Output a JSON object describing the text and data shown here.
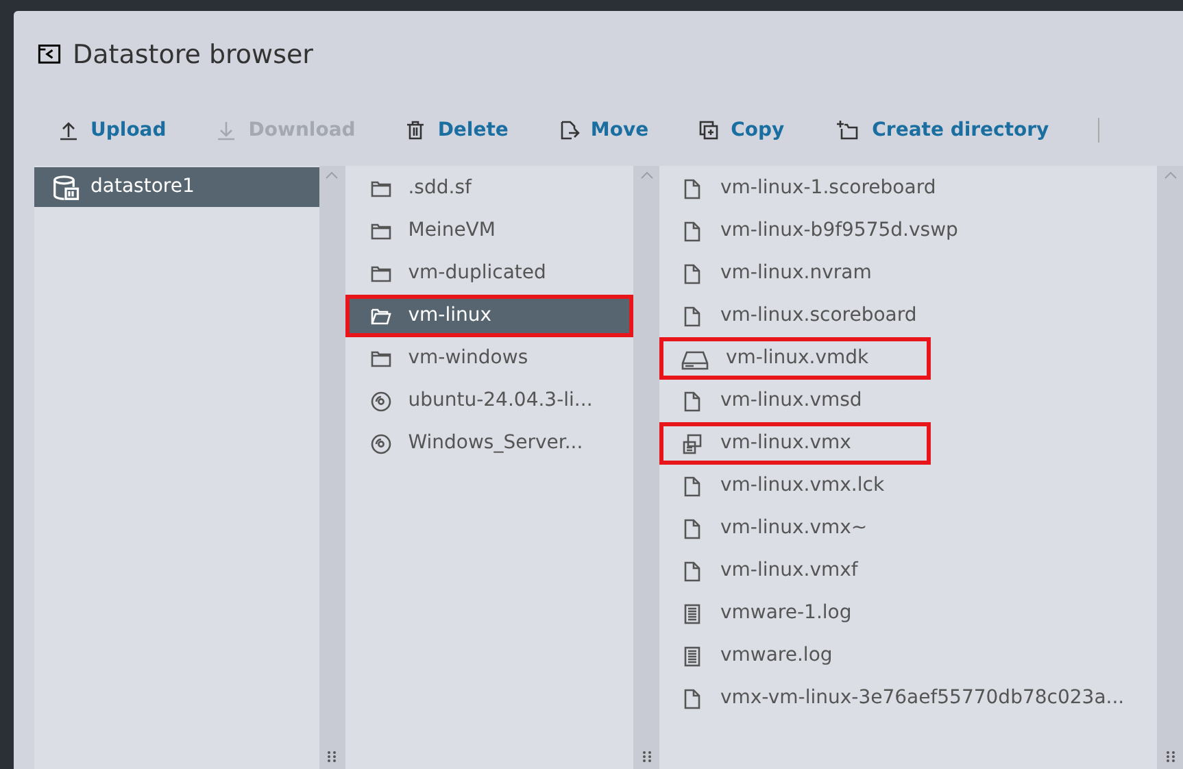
{
  "window": {
    "title": "Datastore browser"
  },
  "toolbar": [
    {
      "label": "Upload",
      "kind": "upload",
      "disabled": false
    },
    {
      "label": "Download",
      "kind": "download",
      "disabled": true
    },
    {
      "label": "Delete",
      "kind": "delete",
      "disabled": false
    },
    {
      "label": "Move",
      "kind": "move",
      "disabled": false
    },
    {
      "label": "Copy",
      "kind": "copy",
      "disabled": false
    },
    {
      "label": "Create directory",
      "kind": "mkdir",
      "disabled": false
    }
  ],
  "datastores": [
    {
      "name": "datastore1",
      "selected": true
    }
  ],
  "folders": [
    {
      "name": ".sdd.sf",
      "kind": "folder",
      "selected": false,
      "highlighted": false
    },
    {
      "name": "MeineVM",
      "kind": "folder",
      "selected": false,
      "highlighted": false
    },
    {
      "name": "vm-duplicated",
      "kind": "folder",
      "selected": false,
      "highlighted": false
    },
    {
      "name": "vm-linux",
      "kind": "folder",
      "selected": true,
      "highlighted": true
    },
    {
      "name": "vm-windows",
      "kind": "folder",
      "selected": false,
      "highlighted": false
    },
    {
      "name": "ubuntu-24.04.3-li...",
      "kind": "disc",
      "selected": false,
      "highlighted": false
    },
    {
      "name": "Windows_Server...",
      "kind": "disc",
      "selected": false,
      "highlighted": false
    }
  ],
  "files": [
    {
      "name": "vm-linux-1.scoreboard",
      "kind": "file",
      "highlighted": false
    },
    {
      "name": "vm-linux-b9f9575d.vswp",
      "kind": "file",
      "highlighted": false
    },
    {
      "name": "vm-linux.nvram",
      "kind": "file",
      "highlighted": false
    },
    {
      "name": "vm-linux.scoreboard",
      "kind": "file",
      "highlighted": false
    },
    {
      "name": "vm-linux.vmdk",
      "kind": "disk",
      "highlighted": true
    },
    {
      "name": "vm-linux.vmsd",
      "kind": "file",
      "highlighted": false
    },
    {
      "name": "vm-linux.vmx",
      "kind": "vm",
      "highlighted": true
    },
    {
      "name": "vm-linux.vmx.lck",
      "kind": "file",
      "highlighted": false
    },
    {
      "name": "vm-linux.vmx~",
      "kind": "file",
      "highlighted": false
    },
    {
      "name": "vm-linux.vmxf",
      "kind": "file",
      "highlighted": false
    },
    {
      "name": "vmware-1.log",
      "kind": "log",
      "highlighted": false
    },
    {
      "name": "vmware.log",
      "kind": "log",
      "highlighted": false
    },
    {
      "name": "vmx-vm-linux-3e76aef55770db78c023a...",
      "kind": "file",
      "highlighted": false
    }
  ]
}
